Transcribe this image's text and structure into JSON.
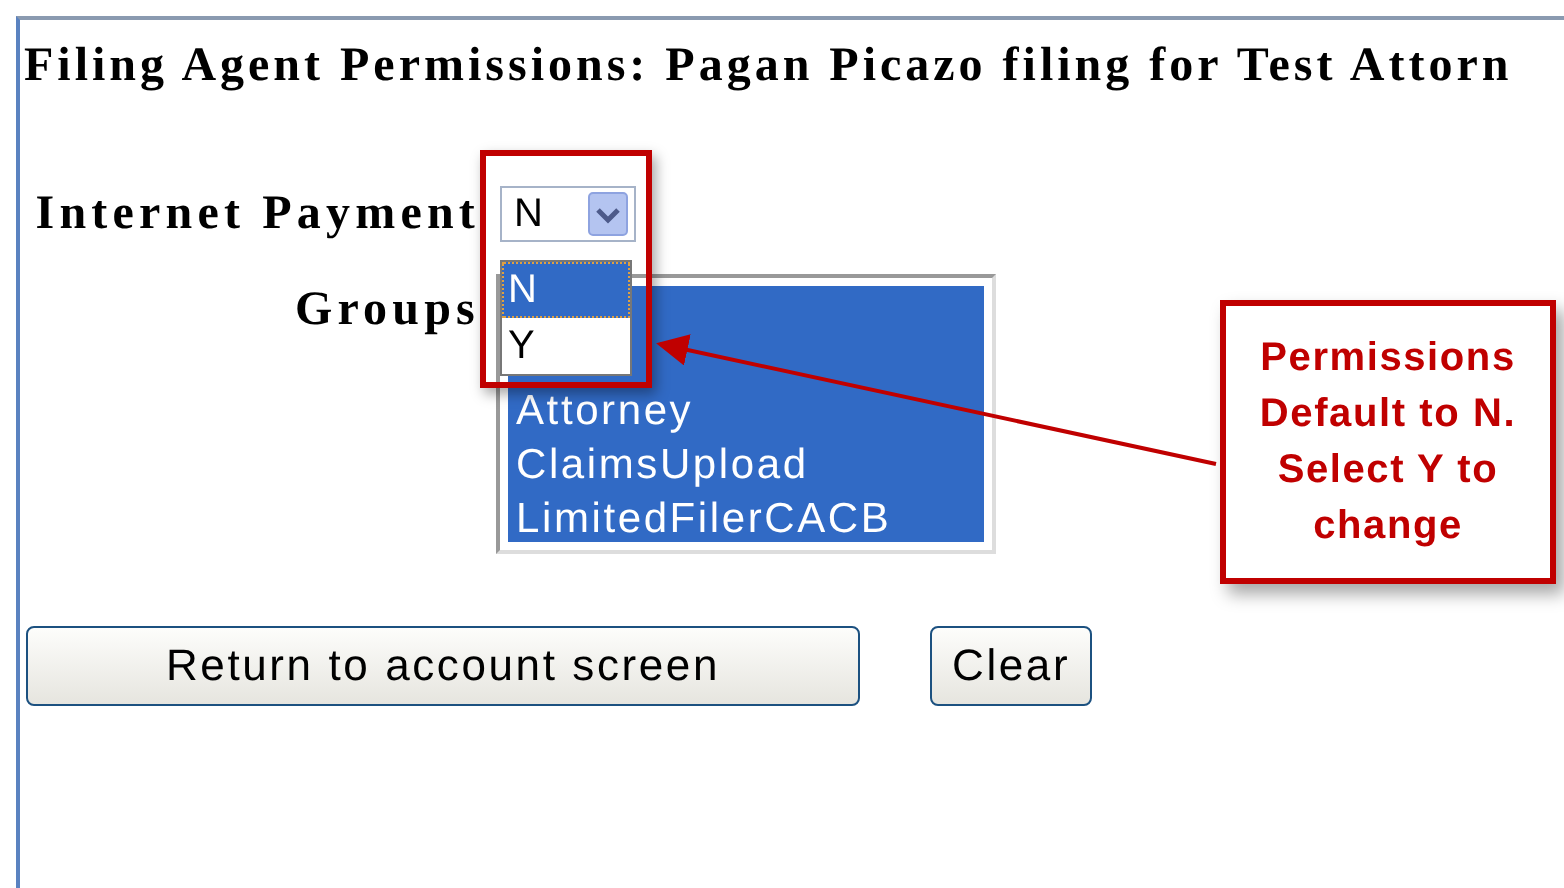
{
  "title": "Filing Agent Permissions: Pagan Picazo filing for Test Attorn",
  "internet_payment": {
    "label": "Internet Payment",
    "value": "N",
    "expanded": true,
    "options": [
      {
        "label": "N",
        "selected": true
      },
      {
        "label": "Y",
        "selected": false
      }
    ]
  },
  "groups": {
    "label": "Groups",
    "items": [
      {
        "label": "Attorney",
        "selected": true
      },
      {
        "label": "ClaimsUpload",
        "selected": true
      },
      {
        "label": "LimitedFilerCACB",
        "selected": true
      }
    ]
  },
  "buttons": [
    {
      "label": "Return to account screen"
    },
    {
      "label": "Clear"
    }
  ],
  "callout": {
    "lines": [
      "Permissions",
      "Default to N.",
      "Select Y to",
      "change"
    ]
  }
}
